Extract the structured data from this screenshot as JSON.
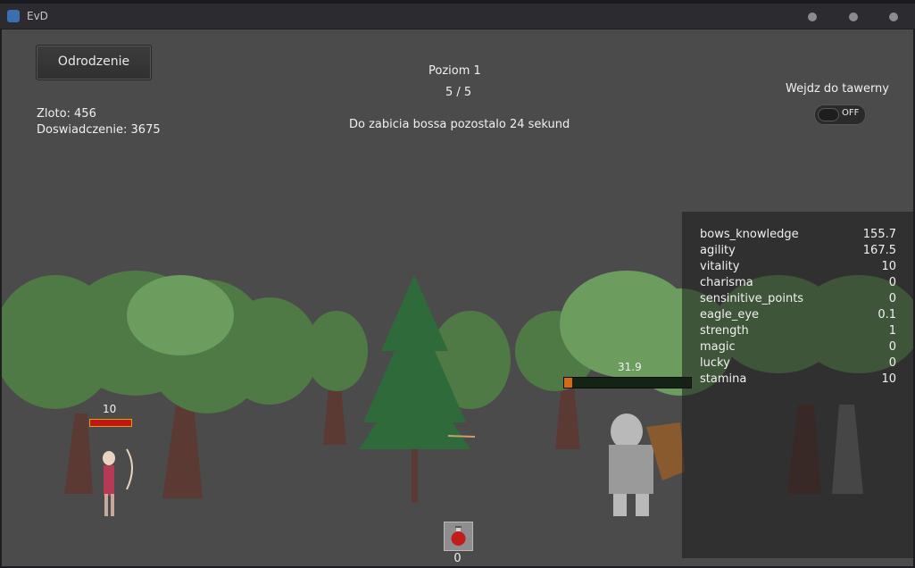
{
  "window": {
    "title": "EvD"
  },
  "game": {
    "respawn_button": "Odrodzenie",
    "level_label": "Poziom 1",
    "wave_progress": "5 / 5",
    "boss_timer_text": "Do zabicia bossa pozostalo 24 sekund",
    "gold": "Zloto: 456",
    "experience": "Doswiadczenie: 3675",
    "tavern_label": "Wejdz do tawerny",
    "tavern_toggle": "OFF",
    "player_hp": "10",
    "player_hp_fraction": 1.0,
    "boss_hp": "31.9",
    "boss_hp_fraction": 0.06,
    "potion_count": "0"
  },
  "stats": [
    {
      "name": "bows_knowledge",
      "value": "155.7"
    },
    {
      "name": "agility",
      "value": "167.5"
    },
    {
      "name": "vitality",
      "value": "10"
    },
    {
      "name": "charisma",
      "value": "0"
    },
    {
      "name": "sensinitive_points",
      "value": "0"
    },
    {
      "name": "eagle_eye",
      "value": "0.1"
    },
    {
      "name": "strength",
      "value": "1"
    },
    {
      "name": "magic",
      "value": "0"
    },
    {
      "name": "lucky",
      "value": "0"
    },
    {
      "name": "stamina",
      "value": "10"
    }
  ],
  "colors": {
    "background": "#4b4b4b",
    "foliage": "#5a8a4e",
    "boss_bar_fill": "#d46a15",
    "player_bar": "#c01616"
  },
  "icons": [
    "app-icon",
    "potion-icon",
    "arrow-projectile",
    "archer-sprite",
    "boss-knight-sprite"
  ]
}
